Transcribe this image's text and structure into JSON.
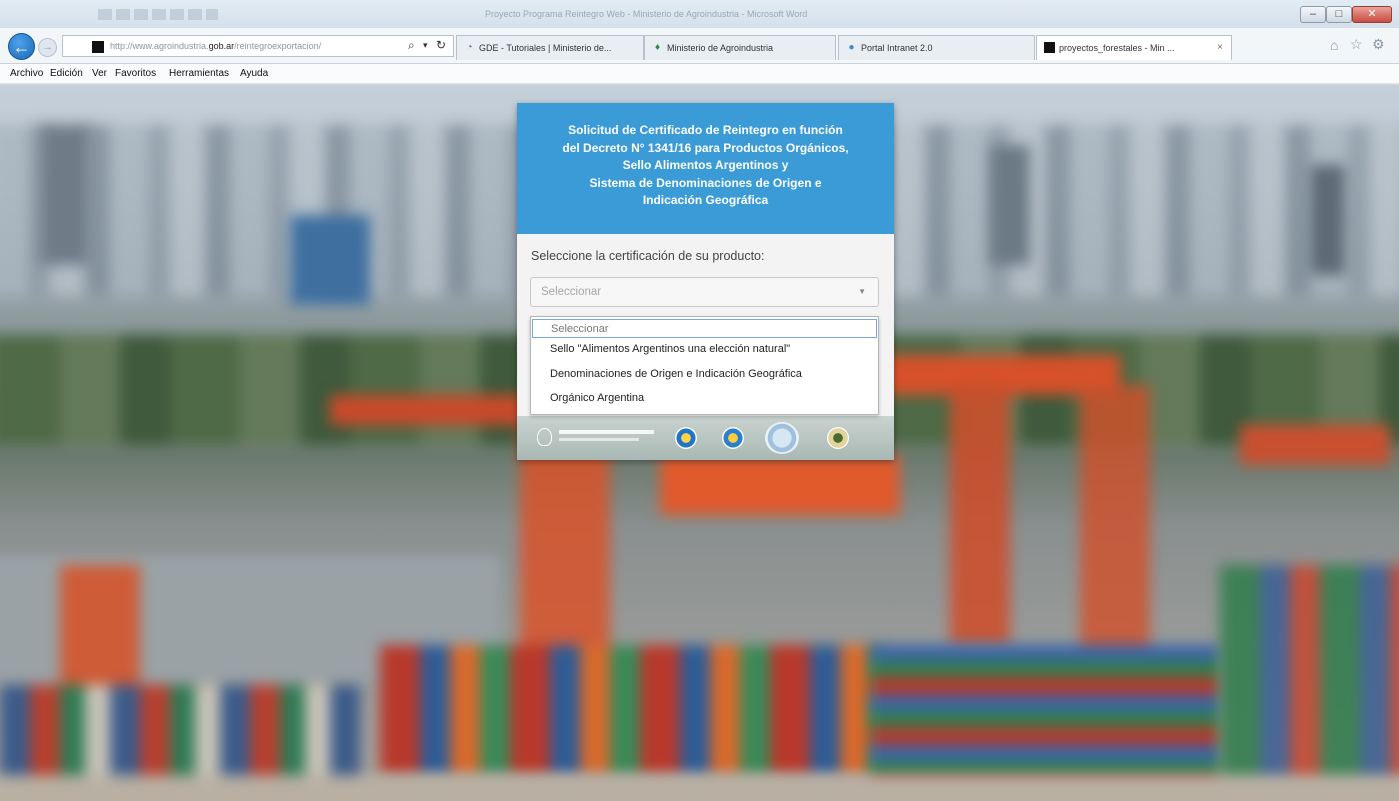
{
  "browser": {
    "window_title": "Proyecto Programa Reintegro Web - Ministerio de Agroindustria - Microsoft Word",
    "address": {
      "prefix": "http://www.agroindustria.",
      "domain": "gob.ar",
      "path": "/reintegroexportacion/"
    },
    "tabs": [
      {
        "label": "GDE - Tutoriales | Ministerio de...",
        "icon": "gde-icon"
      },
      {
        "label": "Ministerio de Agroindustria",
        "icon": "ministry-icon"
      },
      {
        "label": "Portal Intranet 2.0",
        "icon": "portal-icon"
      },
      {
        "label": "proyectos_forestales - Min ...",
        "icon": "site-icon",
        "close": "×"
      }
    ],
    "menu": [
      "Archivo",
      "Edición",
      "Ver",
      "Favoritos",
      "Herramientas",
      "Ayuda"
    ]
  },
  "dialog": {
    "header_lines": [
      "Solicitud de Certificado de Reintegro en función",
      "del Decreto N° 1341/16 para Productos Orgánicos,",
      "Sello Alimentos Argentinos y",
      "Sistema de Denominaciones de Origen e",
      "Indicación Geográfica"
    ],
    "select_label": "Seleccione la certificación de su producto:",
    "select_value": "Seleccionar",
    "options": [
      "Seleccionar",
      "Sello \"Alimentos Argentinos una elección natural\"",
      "Denominaciones de Origen e Indicación Geográfica",
      "Orgánico Argentina"
    ]
  },
  "colors": {
    "header_blue": "#3a9bd6",
    "dialog_bg": "#f3f3f3",
    "back_button": "#1a66b8"
  }
}
